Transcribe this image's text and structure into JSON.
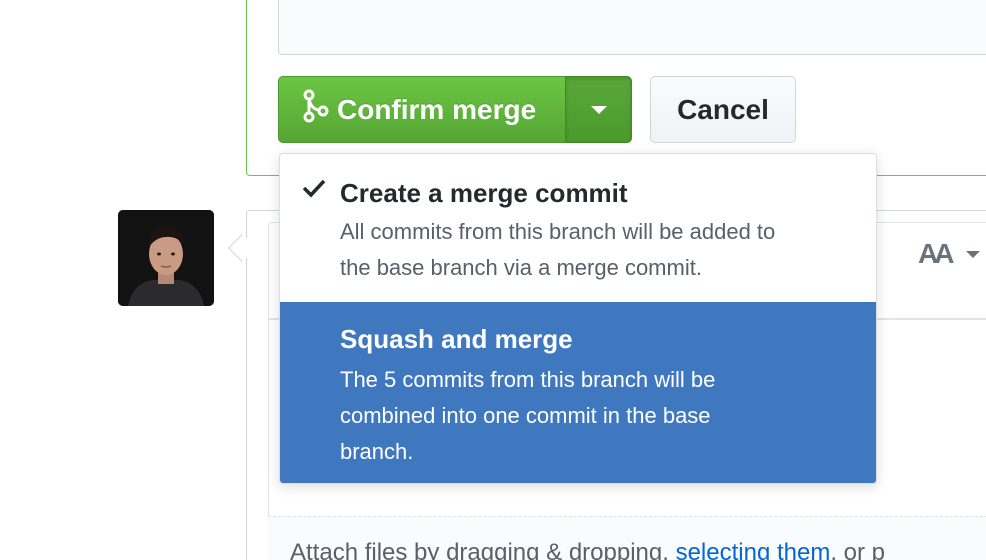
{
  "merge": {
    "confirm_label": "Confirm merge",
    "cancel_label": "Cancel"
  },
  "menu": {
    "items": [
      {
        "title": "Create a merge commit",
        "description_lines": [
          "All commits from this branch will be added to",
          "the base branch via a merge commit."
        ],
        "selected": true
      },
      {
        "title": "Squash and merge",
        "description_lines": [
          "The 5 commits from this branch will be",
          "combined into one commit in the base",
          "branch."
        ],
        "highlighted": true
      }
    ]
  },
  "editor": {
    "text_size_label": "AA",
    "attach_prefix": "Attach files by dragging & dropping, ",
    "attach_link": "selecting them",
    "attach_suffix": ", or p"
  },
  "colors": {
    "merge_green": "#6cc644",
    "highlight_blue": "#4078c0",
    "link_blue": "#0366d6"
  },
  "icons": {
    "merge": "git-merge-icon",
    "caret": "triangle-down-icon",
    "check": "check-icon",
    "text_size": "text-size-icon"
  }
}
